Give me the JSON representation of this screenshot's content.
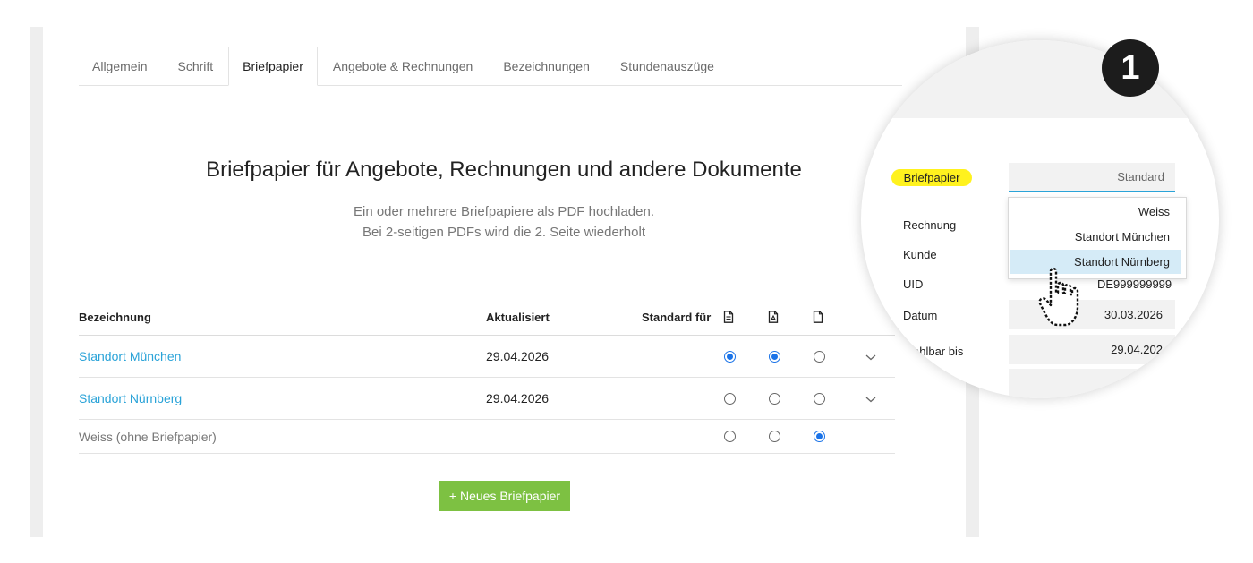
{
  "tabs": [
    "Allgemein",
    "Schrift",
    "Briefpapier",
    "Angebote & Rechnungen",
    "Bezeichnungen",
    "Stundenauszüge"
  ],
  "active_tab": "Briefpapier",
  "heading": "Briefpapier für Angebote, Rechnungen und andere Dokumente",
  "subtitle_line1": "Ein oder mehrere Briefpapiere als PDF hochladen.",
  "subtitle_line2": "Bei 2-seitigen PDFs wird die 2. Seite wiederholt",
  "table": {
    "col_name": "Bezeichnung",
    "col_updated": "Aktualisiert",
    "col_default_for": "Standard für",
    "doc_type_icons": [
      "document-lines-icon",
      "document-pdf-icon",
      "document-blank-icon"
    ],
    "rows": [
      {
        "name": "Standort München",
        "updated": "29.04.2026",
        "defaults": [
          true,
          true,
          false
        ],
        "expandable": true
      },
      {
        "name": "Standort Nürnberg",
        "updated": "29.04.2026",
        "defaults": [
          false,
          false,
          false
        ],
        "expandable": true
      },
      {
        "name": "Weiss (ohne Briefpapier)",
        "updated": "",
        "defaults": [
          false,
          false,
          true
        ],
        "expandable": false
      }
    ]
  },
  "new_button": "+ Neues Briefpapier",
  "zoom": {
    "step": "1",
    "highlight_label": "Briefpapier",
    "select_value": "Standard",
    "options": [
      "Weiss",
      "Standort München",
      "Standort Nürnberg"
    ],
    "selected_option": "Standort Nürnberg",
    "labels": [
      "Rechnung",
      "Kunde",
      "UID",
      "Datum",
      "ahlbar bis"
    ],
    "uid_value": "DE999999999",
    "datum_value": "30.03.2026",
    "zahlbar_value": "29.04.202",
    "partial_value": "D"
  },
  "colors": {
    "link": "#2aa3d8",
    "radio_on": "#1a73e8",
    "button_green": "#7dc142",
    "highlight": "#fff21e",
    "selected_option_bg": "#d5ebf7"
  }
}
